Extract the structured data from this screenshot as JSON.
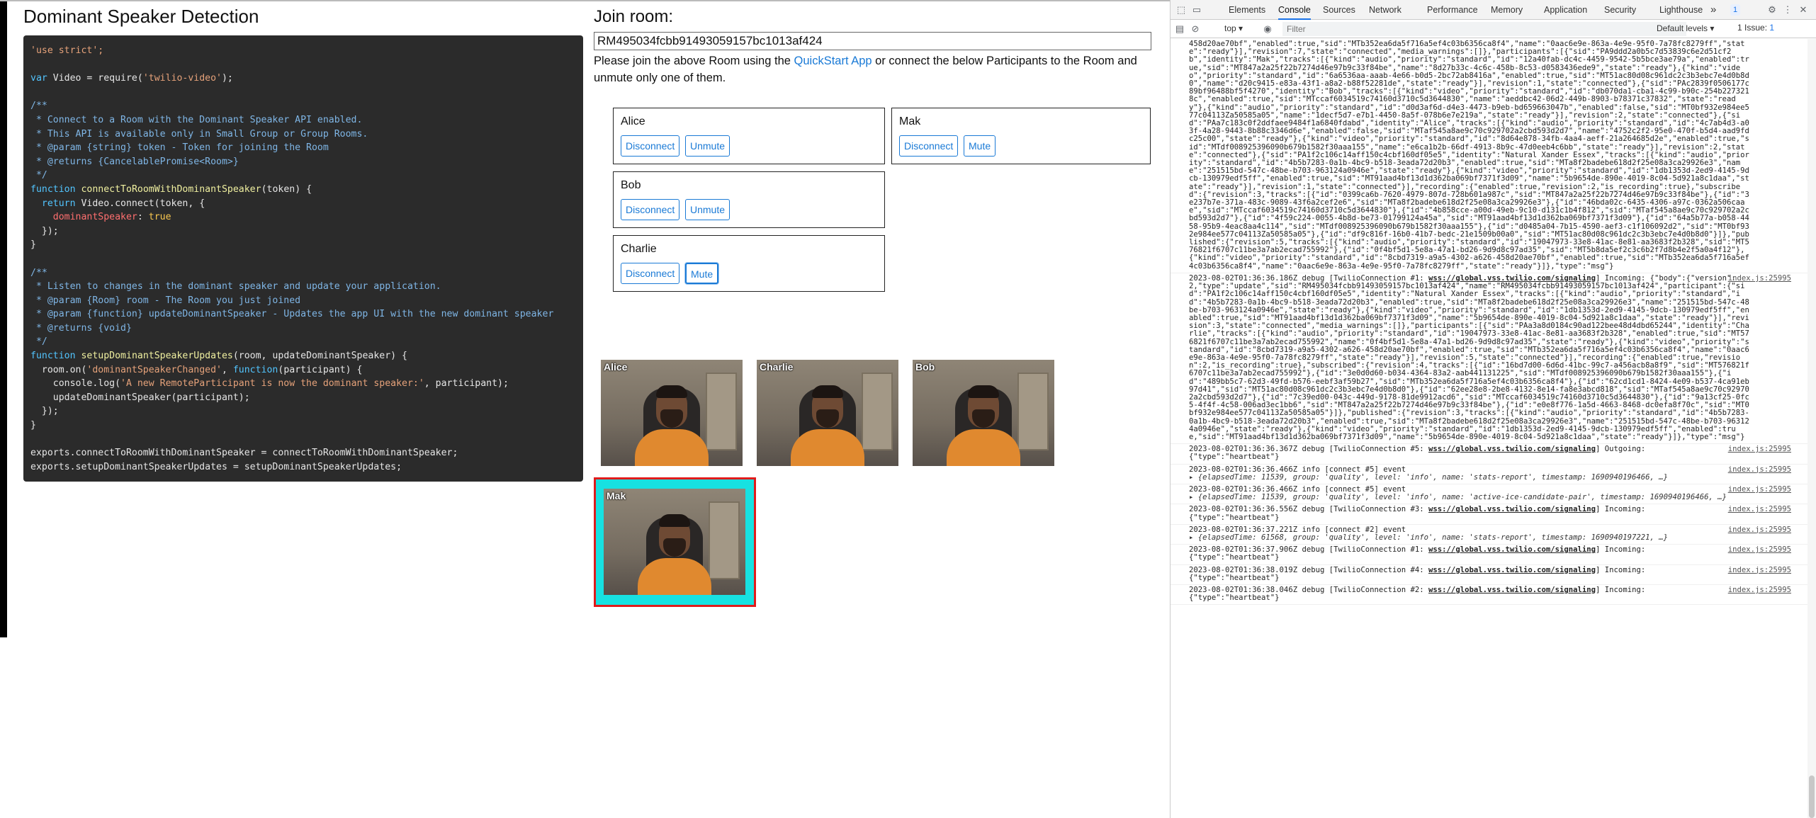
{
  "app": {
    "title": "Dominant Speaker Detection",
    "code_lines": [
      [
        [
          "c-str",
          "'use strict';"
        ]
      ],
      [],
      [
        [
          "c-kw",
          "var"
        ],
        [
          "",
          " Video = require("
        ],
        [
          "c-str",
          "'twilio-video'"
        ],
        [
          "",
          ");"
        ]
      ],
      [],
      [
        [
          "c-cm",
          "/**"
        ]
      ],
      [
        [
          "c-cm",
          " * Connect to a Room with the Dominant Speaker API enabled."
        ]
      ],
      [
        [
          "c-cm",
          " * This API is available only in Small Group or Group Rooms."
        ]
      ],
      [
        [
          "c-cm",
          " * @param {string} token - Token for joining the Room"
        ]
      ],
      [
        [
          "c-cm",
          " * @returns {CancelablePromise<Room>}"
        ]
      ],
      [
        [
          "c-cm",
          " */"
        ]
      ],
      [
        [
          "c-kw",
          "function"
        ],
        [
          "",
          " "
        ],
        [
          "c-fn",
          "connectToRoomWithDominantSpeaker"
        ],
        [
          "",
          "(token) {"
        ]
      ],
      [
        [
          "",
          "  "
        ],
        [
          "c-kw",
          "return"
        ],
        [
          "",
          " Video.connect(token, {"
        ]
      ],
      [
        [
          "",
          "    "
        ],
        [
          "c-prop",
          "dominantSpeaker"
        ],
        [
          "",
          ": "
        ],
        [
          "c-kw2",
          "true"
        ]
      ],
      [
        [
          "",
          "  });"
        ]
      ],
      [
        [
          "",
          "}"
        ]
      ],
      [],
      [
        [
          "c-cm",
          "/**"
        ]
      ],
      [
        [
          "c-cm",
          " * Listen to changes in the dominant speaker and update your application."
        ]
      ],
      [
        [
          "c-cm",
          " * @param {Room} room - The Room you just joined"
        ]
      ],
      [
        [
          "c-cm",
          " * @param {function} updateDominantSpeaker - Updates the app UI with the new dominant speaker"
        ]
      ],
      [
        [
          "c-cm",
          " * @returns {void}"
        ]
      ],
      [
        [
          "c-cm",
          " */"
        ]
      ],
      [
        [
          "c-kw",
          "function"
        ],
        [
          "",
          " "
        ],
        [
          "c-fn",
          "setupDominantSpeakerUpdates"
        ],
        [
          "",
          "(room, updateDominantSpeaker) {"
        ]
      ],
      [
        [
          "",
          "  room.on("
        ],
        [
          "c-str",
          "'dominantSpeakerChanged'"
        ],
        [
          "",
          ", "
        ],
        [
          "c-kw",
          "function"
        ],
        [
          "",
          "(participant) {"
        ]
      ],
      [
        [
          "",
          "    console.log("
        ],
        [
          "c-str",
          "'A new RemoteParticipant is now the dominant speaker:'"
        ],
        [
          "",
          ", participant);"
        ]
      ],
      [
        [
          "",
          "    updateDominantSpeaker(participant);"
        ]
      ],
      [
        [
          "",
          "  });"
        ]
      ],
      [
        [
          "",
          "}"
        ]
      ],
      [],
      [
        [
          "",
          "exports.connectToRoomWithDominantSpeaker = connectToRoomWithDominantSpeaker;"
        ]
      ],
      [
        [
          "",
          "exports.setupDominantSpeakerUpdates = setupDominantSpeakerUpdates;"
        ]
      ]
    ],
    "join": {
      "title": "Join room:",
      "room_sid": "RM495034fcbb91493059157bc1013af424",
      "info_before": "Please join the above Room using the ",
      "info_link": "QuickStart App",
      "info_after": " or connect the below Participants to the Room and unmute only one of them."
    },
    "participants": [
      {
        "name": "Alice",
        "disconnect": "Disconnect",
        "toggle": "Unmute"
      },
      {
        "name": "Mak",
        "disconnect": "Disconnect",
        "toggle": "Mute"
      },
      {
        "name": "Bob",
        "disconnect": "Disconnect",
        "toggle": "Unmute"
      },
      {
        "name": "Charlie",
        "disconnect": "Disconnect",
        "toggle": "Mute"
      }
    ],
    "video_tiles": [
      "Alice",
      "Charlie",
      "Bob"
    ],
    "dominant_tile": "Mak",
    "dominant_colors": {
      "border": "#e01b1b",
      "fill": "#17e1e1"
    }
  },
  "devtools": {
    "tabs": [
      "Elements",
      "Console",
      "Sources",
      "Network",
      "Performance",
      "Memory",
      "Application",
      "Security",
      "Lighthouse"
    ],
    "active_tab": "Console",
    "more_tabs": "»",
    "badge": "1",
    "context": "top ▾",
    "filter_placeholder": "Filter",
    "levels": "Default levels ▾",
    "issues_label": "1 Issue: ",
    "issues_count": "1",
    "log_blocks": [
      {
        "text": "458d20ae70bf\",\"enabled\":true,\"sid\":\"MTb352ea6da5f716a5ef4c03b6356ca8f4\",\"name\":\"0aac6e9e-863a-4e9e-95f0-7a78fc8279ff\",\"state\":\"ready\"}],\"revision\":7,\"state\":\"connected\",\"media_warnings\":[]},\"participants\":[{\"sid\":\"PA9ddd2a0b5c7d53839c6e2d51cf2b\",\"identity\":\"Mak\",\"tracks\":[{\"kind\":\"audio\",\"priority\":\"standard\",\"id\":\"12a40fab-dc4c-4459-9542-5b5bce3ae79a\",\"enabled\":true,\"sid\":\"MT847a2a25f22b7274d46e97b9c33f84be\",\"name\":\"8d27b33c-4c6c-458b-8c53-d0583436ede9\",\"state\":\"ready\"},{\"kind\":\"video\",\"priority\":\"standard\",\"id\":\"6a6536aa-aaab-4e66-b0d5-2bc72ab8416a\",\"enabled\":true,\"sid\":\"MT51ac80d08c961dc2c3b3ebc7e4d0b8d0\",\"name\":\"d20c9415-e83a-43f1-a8a2-b88f52281de\",\"state\":\"ready\"}],\"revision\":1,\"state\":\"connected\"},{\"sid\":\"PAc2839f0506177c89bf96488bf5f4270\",\"identity\":\"Bob\",\"tracks\":[{\"kind\":\"video\",\"priority\":\"standard\",\"id\":\"db070da1-cba1-4c99-b90c-254b2273218c\",\"enabled\":true,\"sid\":\"MTccaf6034519c74160d3710c5d3644830\",\"name\":\"aeddbc42-06d2-449b-8903-b78371c37832\",\"state\":\"ready\"},{\"kind\":\"audio\",\"priority\":\"standard\",\"id\":\"d0d3af6d-d4e3-4473-b9eb-bd659663047b\",\"enabled\":false,\"sid\":\"MT0bf932e984ee577c04113Za50585a05\",\"name\":\"1decf5d7-e7b1-4450-8a5f-078b6e7e219a\",\"state\":\"ready\"}],\"revision\":2,\"state\":\"connected\"},{\"sid\":\"PAa7c183c0f2ddfaee9484f1a6840fdabd\",\"identity\":\"Alice\",\"tracks\":[{\"kind\":\"audio\",\"priority\":\"standard\",\"id\":\"4c7ab4d3-a03f-4a28-9443-8b88c3346d6e\",\"enabled\":false,\"sid\":\"MTaf545a8ae9c70c929702a2cbd593d2d7\",\"name\":\"4752c2f2-95e0-470f-b5d4-aad9fdc25c00\",\"state\":\"ready\"},{\"kind\":\"video\",\"priority\":\"standard\",\"id\":\"8d64e878-34fb-4aa4-aeff-21a264685d2e\",\"enabled\":true,\"sid\":\"MTdf008925396090b679b1582f30aaa155\",\"name\":\"e6ca1b2b-66df-4913-8b9c-47d0eeb4c6bb\",\"state\":\"ready\"}],\"revision\":2,\"state\":\"connected\"},{\"sid\":\"PA1f2c106c14aff150c4cbf160df05e5\",\"identity\":\"Natural Xander Essex\",\"tracks\":[{\"kind\":\"audio\",\"priority\":\"standard\",\"id\":\"4b5b7283-0a1b-4bc9-b518-3eada72d20b3\",\"enabled\":true,\"sid\":\"MTa8f2badebe618d2f25e08a3ca29926e3\",\"name\":\"251515bd-547c-48be-b703-963124a0946e\",\"state\":\"ready\"},{\"kind\":\"video\",\"priority\":\"standard\",\"id\":\"1db1353d-2ed9-4145-9dcb-130979edf5ff\",\"enabled\":true,\"sid\":\"MT91aad4bf13d1d362ba069bf7371f3d09\",\"name\":\"5b9654de-890e-4019-8c04-5d921a8c1daa\",\"state\":\"ready\"}],\"revision\":1,\"state\":\"connected\"}],\"recording\":{\"enabled\":true,\"revision\":2,\"is_recording\":true},\"subscribed\":{\"revision\":3,\"tracks\":[{\"id\":\"0399ca6b-7620-4979-807d-728b601a987c\",\"sid\":\"MT847a2a25f22b7274d46e97b9c33f84be\"},{\"id\":\"3e237b7e-371a-483c-9089-43f6a2cef2e6\",\"sid\":\"MTa8f2badebe618d2f25e08a3ca29926e3\"},{\"id\":\"46bda02c-6435-4306-a97c-0362a506caae\",\"sid\":\"MTccaf6034519c74160d3710c5d3644830\"},{\"id\":\"4b858cce-a00d-49eb-9c10-d131c1b4f812\",\"sid\":\"MTaf545a8ae9c70c929702a2cbd593d2d7\"},{\"id\":\"4f59c224-0055-4b8d-be73-01799124a45a\",\"sid\":\"MT91aad4bf13d1d362ba069bf7371f3d09\"},{\"id\":\"64a5b77a-b058-4458-95b9-4eac8aa4c114\",\"sid\":\"MTdf008925396090b679b1582f30aaa155\"},{\"id\":\"d0485a04-7b15-4590-aef3-c1f106092d2\",\"sid\":\"MT0bf932e984ee577c04113Za50585a05\"},{\"id\":\"df9c816f-16b0-41b7-bedc-21e1509b00a0\",\"sid\":\"MT51ac80d08c961dc2c3b3ebc7e4d0b8d0\"}]},\"published\":{\"revision\":5,\"tracks\":[{\"kind\":\"audio\",\"priority\":\"standard\",\"id\":\"19047973-33e8-41ac-8e81-aa3683f2b328\",\"sid\":\"MT576821f6707c11be3a7ab2ecad755992\"},{\"id\":\"0f4bf5d1-5e8a-47a1-bd26-9d9d8c97ad35\",\"sid\":\"MT5b8da5ef2c3c6b2f7d8b4e2f5a0a4f12\"},{\"kind\":\"video\",\"priority\":\"standard\",\"id\":\"8cbd7319-a9a5-4302-a626-458d20ae70bf\",\"enabled\":true,\"sid\":\"MTb352ea6da5f716a5ef4c03b6356ca8f4\",\"name\":\"0aac6e9e-863a-4e9e-95f0-7a78fc8279ff\",\"state\":\"ready\"}]},\"type\":\"msg\"}",
        "src": ""
      },
      {
        "pre": "2023-08-02T01:36:36.186Z debug [TwilioConnection #1: ",
        "url": "wss://global.vss.twilio.com/signaling",
        "post": "] Incoming: {\"body\":{\"version\":2,\"type\":\"update\",\"sid\":\"RM495034fcbb91493059157bc1013af424\",\"name\":\"RM495034fcbb91493059157bc1013af424\",\"participant\":{\"sid\":\"PA1f2c106c14aff150c4cbf160df05e5\",\"identity\":\"Natural Xander Essex\",\"tracks\":[{\"kind\":\"audio\",\"priority\":\"standard\",\"id\":\"4b5b7283-0a1b-4bc9-b518-3eada72d20b3\",\"enabled\":true,\"sid\":\"MTa8f2badebe618d2f25e08a3ca29926e3\",\"name\":\"251515bd-547c-48be-b703-963124a0946e\",\"state\":\"ready\"},{\"kind\":\"video\",\"priority\":\"standard\",\"id\":\"1db1353d-2ed9-4145-9dcb-130979edf5ff\",\"enabled\":true,\"sid\":\"MT91aad4bf13d1d362ba069bf7371f3d09\",\"name\":\"5b9654de-890e-4019-8c04-5d921a8c1daa\",\"state\":\"ready\"}],\"revision\":3,\"state\":\"connected\",\"media_warnings\":[]},\"participants\":[{\"sid\":\"PAa3a8d0184c90ad122bee48d4dbd65244\",\"identity\":\"Charlie\",\"tracks\":[{\"kind\":\"audio\",\"priority\":\"standard\",\"id\":\"19047973-33e8-41ac-8e81-aa3683f2b328\",\"enabled\":true,\"sid\":\"MT576821f6707c11be3a7ab2ecad755992\",\"name\":\"0f4bf5d1-5e8a-47a1-bd26-9d9d8c97ad35\",\"state\":\"ready\"},{\"kind\":\"video\",\"priority\":\"standard\",\"id\":\"8cbd7319-a9a5-4302-a626-458d20ae70bf\",\"enabled\":true,\"sid\":\"MTb352ea6da5f716a5ef4c03b6356ca8f4\",\"name\":\"0aac6e9e-863a-4e9e-95f0-7a78fc8279ff\",\"state\":\"ready\"}],\"revision\":5,\"state\":\"connected\"}],\"recording\":{\"enabled\":true,\"revision\":2,\"is_recording\":true},\"subscribed\":{\"revision\":4,\"tracks\":[{\"id\":\"16bd7d00-6d6d-41bc-99c7-a456acb8a8f9\",\"sid\":\"MT576821f6707c11be3a7ab2ecad755992\"},{\"id\":\"3e0d0d60-b034-4364-83a2-aab441131225\",\"sid\":\"MTdf008925396090b679b1582f30aaa155\"},{\"id\":\"489bb5c7-62d3-49fd-b576-eebf3af59b27\",\"sid\":\"MTb352ea6da5f716a5ef4c03b6356ca8f4\"},{\"id\":\"62cd1cd1-8424-4e09-b537-4ca91eb97d41\",\"sid\":\"MT51ac80d08c961dc2c3b3ebc7e4d0b8d0\"},{\"id\":\"62ee28e8-2be8-4132-8e14-fa8e3abcd818\",\"sid\":\"MTaf545a8ae9c70c929702a2cbd593d2d7\"},{\"id\":\"7c39ed00-043c-449d-9178-81de9912acd6\",\"sid\":\"MTccaf6034519c74160d3710c5d3644830\"},{\"id\":\"9a13cf25-0fc5-4f4f-4c58-006ad3ec1bb6\",\"sid\":\"MT847a2a25f22b7274d46e97b9c33f84be\"},{\"id\":\"e0e8f776-1a5d-4663-8468-dc0efa8f70c\",\"sid\":\"MT0bf932e984ee577c04113Za50585a05\"}]},\"published\":{\"revision\":3,\"tracks\":[{\"kind\":\"audio\",\"priority\":\"standard\",\"id\":\"4b5b7283-0a1b-4bc9-b518-3eada72d20b3\",\"enabled\":true,\"sid\":\"MTa8f2badebe618d2f25e08a3ca29926e3\",\"name\":\"251515bd-547c-48be-b703-963124a0946e\",\"state\":\"ready\"},{\"kind\":\"video\",\"priority\":\"standard\",\"id\":\"1db1353d-2ed9-4145-9dcb-130979edf5ff\",\"enabled\":true,\"sid\":\"MT91aad4bf13d1d362ba069bf7371f3d09\",\"name\":\"5b9654de-890e-4019-8c04-5d921a8c1daa\",\"state\":\"ready\"}]},\"type\":\"msg\"}",
        "src": "index.js:25995"
      },
      {
        "pre": "2023-08-02T01:36:36.367Z debug [TwilioConnection #5: ",
        "url": "wss://global.vss.twilio.com/signaling",
        "post": "] Outgoing:\n{\"type\":\"heartbeat\"}",
        "src": "index.js:25995"
      },
      {
        "pre": "2023-08-02T01:36:36.466Z info [connect #5] event",
        "src": "index.js:25995",
        "obj": "▸ {elapsedTime: 11539, group: 'quality', level: 'info', name: 'stats-report', timestamp: 1690940196466, …}"
      },
      {
        "pre": "2023-08-02T01:36:36.466Z info [connect #5] event",
        "src": "index.js:25995",
        "obj": "▸ {elapsedTime: 11539, group: 'quality', level: 'info', name: 'active-ice-candidate-pair', timestamp: 1690940196466, …}"
      },
      {
        "pre": "2023-08-02T01:36:36.556Z debug [TwilioConnection #3: ",
        "url": "wss://global.vss.twilio.com/signaling",
        "post": "] Incoming:\n{\"type\":\"heartbeat\"}",
        "src": "index.js:25995"
      },
      {
        "pre": "2023-08-02T01:36:37.221Z info [connect #2] event",
        "src": "index.js:25995",
        "obj": "▸ {elapsedTime: 61568, group: 'quality', level: 'info', name: 'stats-report', timestamp: 1690940197221, …}"
      },
      {
        "pre": "2023-08-02T01:36:37.906Z debug [TwilioConnection #1: ",
        "url": "wss://global.vss.twilio.com/signaling",
        "post": "] Incoming:\n{\"type\":\"heartbeat\"}",
        "src": "index.js:25995"
      },
      {
        "pre": "2023-08-02T01:36:38.019Z debug [TwilioConnection #4: ",
        "url": "wss://global.vss.twilio.com/signaling",
        "post": "] Incoming:\n{\"type\":\"heartbeat\"}",
        "src": "index.js:25995"
      },
      {
        "pre": "2023-08-02T01:36:38.046Z debug [TwilioConnection #2: ",
        "url": "wss://global.vss.twilio.com/signaling",
        "post": "] Incoming:\n{\"type\":\"heartbeat\"}",
        "src": "index.js:25995"
      }
    ]
  }
}
